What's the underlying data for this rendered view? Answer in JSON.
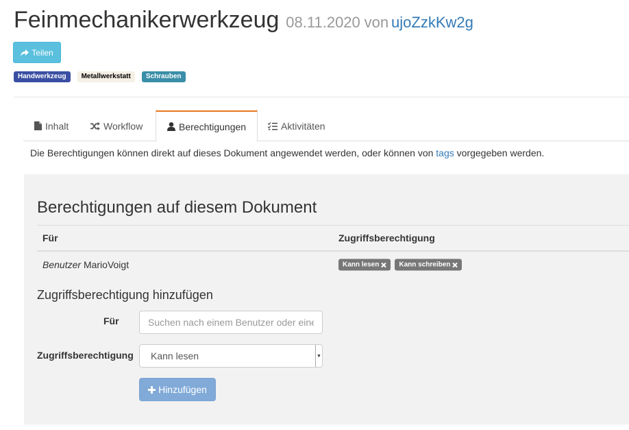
{
  "document": {
    "title": "Feinmechanikerwerkzeug",
    "date": "08.11.2020",
    "by": "von",
    "author": "ujoZzkKw2g"
  },
  "share_button": {
    "label": "Teilen",
    "icon": "share-icon"
  },
  "tags": [
    {
      "label": "Handwerkzeug",
      "bg": "#3a4fa3",
      "color": "#ffffff"
    },
    {
      "label": "Metallwerkstatt",
      "bg": "#f5f0e6",
      "color": "#000000"
    },
    {
      "label": "Schrauben",
      "bg": "#3a8ea8",
      "color": "#ffffff"
    }
  ],
  "tabs": [
    {
      "label": "Inhalt",
      "icon": "file-icon"
    },
    {
      "label": "Workflow",
      "icon": "shuffle-icon"
    },
    {
      "label": "Berechtigungen",
      "icon": "user-icon",
      "active": true
    },
    {
      "label": "Aktivitäten",
      "icon": "checklist-icon"
    }
  ],
  "description": {
    "before": "Die Berechtigungen können direkt auf dieses Dokument angewendet werden, oder können von ",
    "link": "tags",
    "after": " vorgegeben werden."
  },
  "permissions": {
    "title": "Berechtigungen auf diesem Dokument",
    "columns": [
      "Für",
      "Zugriffsberechtigung"
    ],
    "rows": [
      {
        "type": "Benutzer",
        "name": "MarioVoigt",
        "rights": [
          "Kann lesen",
          "Kann schreiben"
        ]
      }
    ]
  },
  "add_form": {
    "title": "Zugriffsberechtigung hinzufügen",
    "for_label": "Für",
    "search_placeholder": "Suchen nach einem Benutzer oder einer Gruppe",
    "access_label": "Zugriffsberechtigung",
    "access_value": "Kann lesen",
    "submit_label": "Hinzufügen"
  },
  "colors": {
    "accent": "#e8761d",
    "link": "#337ab7",
    "info": "#5bc0de",
    "badge": "#777777"
  }
}
